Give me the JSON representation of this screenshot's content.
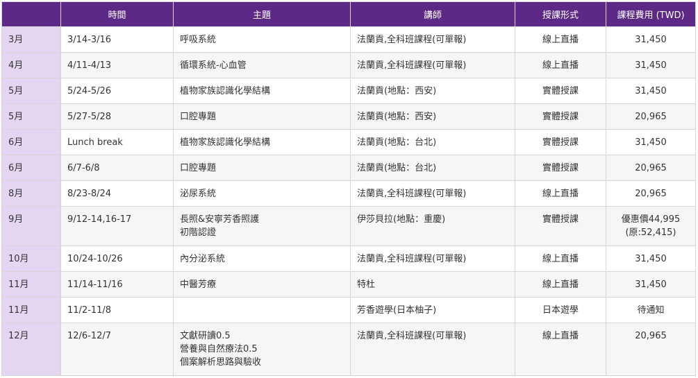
{
  "headers": [
    "",
    "時間",
    "主題",
    "講師",
    "授課形式",
    "課程費用 (TWD)"
  ],
  "rows": [
    {
      "month": "3月",
      "time": "3/14-3/16",
      "topic": [
        "呼吸系統"
      ],
      "teacher": "法蘭貢,全科班課程(可單報)",
      "format": "線上直播",
      "fee": [
        "31,450"
      ]
    },
    {
      "month": "4月",
      "time": "4/11-4/13",
      "topic": [
        "循環系統-心血管"
      ],
      "teacher": "法蘭貢,全科班課程(可單報)",
      "format": "線上直播",
      "fee": [
        "31,450"
      ]
    },
    {
      "month": "5月",
      "time": "5/24-5/26",
      "topic": [
        "植物家族認識化學結構"
      ],
      "teacher": "法蘭貢(地點：西安)",
      "format": "實體授課",
      "fee": [
        "31,450"
      ]
    },
    {
      "month": "5月",
      "time": "5/27-5/28",
      "topic": [
        "口腔專題"
      ],
      "teacher": "法蘭貢(地點：西安)",
      "format": "實體授課",
      "fee": [
        "20,965"
      ]
    },
    {
      "month": "6月",
      "time": "Lunch break",
      "topic": [
        "植物家族認識化學結構"
      ],
      "teacher": "法蘭貢(地點：台北)",
      "format": "實體授課",
      "fee": [
        "31,450"
      ]
    },
    {
      "month": "6月",
      "time": "6/7-6/8",
      "topic": [
        "口腔專題"
      ],
      "teacher": "法蘭貢(地點：台北)",
      "format": "實體授課",
      "fee": [
        "20,965"
      ]
    },
    {
      "month": "8月",
      "time": "8/23-8/24",
      "topic": [
        "泌尿系統"
      ],
      "teacher": "法蘭貢,全科班課程(可單報)",
      "format": "線上直播",
      "fee": [
        "20,965"
      ]
    },
    {
      "month": "9月",
      "time": "9/12-14,16-17",
      "topic": [
        "長照&安寧芳香照護",
        "初階認證"
      ],
      "teacher": "伊莎貝拉(地點：重慶)",
      "format": "實體授課",
      "fee": [
        "優惠價44,995",
        "(原:52,415)"
      ]
    },
    {
      "month": "10月",
      "time": "10/24-10/26",
      "topic": [
        "內分泌系統"
      ],
      "teacher": "法蘭貢,全科班課程(可單報)",
      "format": "線上直播",
      "fee": [
        "31,450"
      ]
    },
    {
      "month": "11月",
      "time": "11/14-11/16",
      "topic": [
        "中醫芳療"
      ],
      "teacher": "特杜",
      "format": "線上直播",
      "fee": [
        "31,450"
      ]
    },
    {
      "month": "11月",
      "time": "11/2-11/8",
      "topic": [],
      "teacher": "芳香遊學(日本柚子)",
      "format": "日本遊學",
      "fee": [
        "待通知"
      ]
    },
    {
      "month": "12月",
      "time": "12/6-12/7",
      "topic": [
        "文獻研讀0.5",
        "營養與自然療法0.5",
        "個案解析思路與驗收"
      ],
      "teacher": "法蘭貢,全科班課程(可單報)",
      "format": "線上直播",
      "fee": [
        "20,965"
      ]
    }
  ],
  "colors": {
    "header_bg": "#5c2a86",
    "month_bg": "#e4d6f2",
    "stripe_bg": "#f6f6f6"
  }
}
